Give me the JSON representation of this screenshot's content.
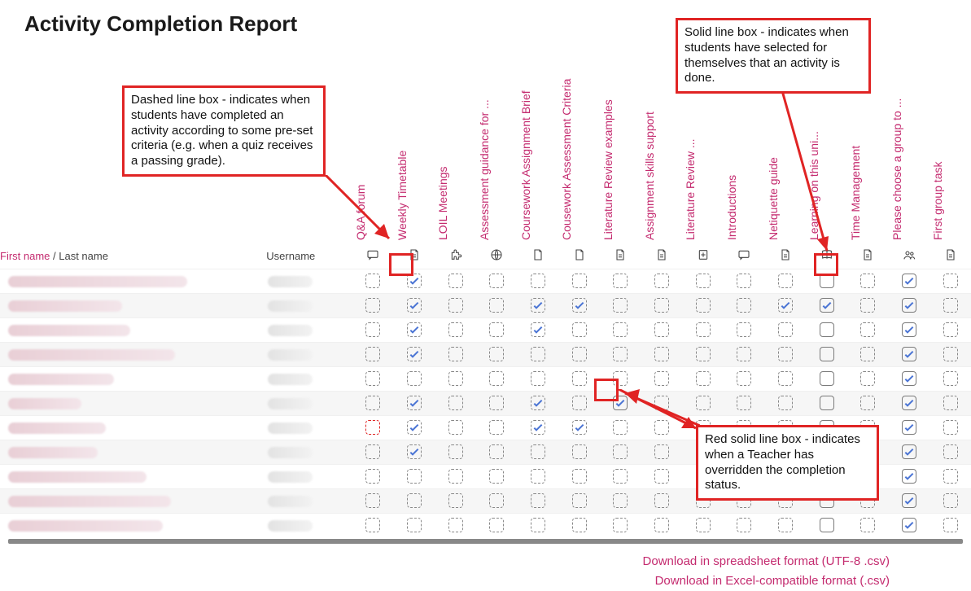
{
  "title": "Activity Completion Report",
  "header": {
    "first": "First name",
    "sep": " / ",
    "last": "Last name",
    "user": "Username"
  },
  "activities": [
    {
      "name": "Q&A forum",
      "icon": "forum"
    },
    {
      "name": "Weekly Timetable",
      "icon": "page"
    },
    {
      "name": "LOIL Meetings",
      "icon": "puzzle"
    },
    {
      "name": "Assessment guidance for ...",
      "icon": "globe"
    },
    {
      "name": "Coursework Assignment Brief",
      "icon": "file"
    },
    {
      "name": "Cousework Assessment Criteria",
      "icon": "file"
    },
    {
      "name": "Literature Review examples",
      "icon": "page"
    },
    {
      "name": "Assignment skills support",
      "icon": "page"
    },
    {
      "name": "Literature Review ...",
      "icon": "doc"
    },
    {
      "name": "Introductions",
      "icon": "forum"
    },
    {
      "name": "Netiquette guide",
      "icon": "page"
    },
    {
      "name": "Learning on this uni...",
      "icon": "book"
    },
    {
      "name": "Time Management",
      "icon": "page"
    },
    {
      "name": "Please choose a group to ...",
      "icon": "group"
    },
    {
      "name": "First group task",
      "icon": "page"
    }
  ],
  "icon_map": {
    "forum": "forum",
    "page": "page",
    "puzzle": "puzzle",
    "globe": "globe",
    "file": "file",
    "doc": "doc",
    "book": "book",
    "group": "group"
  },
  "students": [
    {
      "nw": 220,
      "cells": [
        "d",
        "dc",
        "d",
        "d",
        "d",
        "d",
        "d",
        "d",
        "d",
        "d",
        "d",
        "s",
        "d",
        "sc",
        "d"
      ]
    },
    {
      "nw": 140,
      "cells": [
        "d",
        "dc",
        "d",
        "d",
        "dc",
        "dc",
        "d",
        "d",
        "d",
        "d",
        "dc",
        "sc",
        "d",
        "sc",
        "d"
      ]
    },
    {
      "nw": 150,
      "cells": [
        "d",
        "dc",
        "d",
        "d",
        "dc",
        "d",
        "d",
        "d",
        "d",
        "d",
        "d",
        "s",
        "d",
        "sc",
        "d"
      ]
    },
    {
      "nw": 205,
      "cells": [
        "d",
        "dc",
        "d",
        "d",
        "d",
        "d",
        "d",
        "d",
        "d",
        "d",
        "d",
        "s",
        "d",
        "sc",
        "d"
      ]
    },
    {
      "nw": 130,
      "cells": [
        "d",
        "d",
        "d",
        "d",
        "d",
        "d",
        "d",
        "d",
        "d",
        "d",
        "d",
        "s",
        "d",
        "sc",
        "d"
      ]
    },
    {
      "nw": 90,
      "cells": [
        "d",
        "dc",
        "d",
        "d",
        "dc",
        "d",
        "sc",
        "d",
        "d",
        "d",
        "d",
        "s",
        "d",
        "sc",
        "d"
      ]
    },
    {
      "nw": 120,
      "cells": [
        "rd",
        "dc",
        "d",
        "d",
        "dc",
        "dc",
        "d",
        "d",
        "d",
        "d",
        "d",
        "s",
        "d",
        "sc",
        "d"
      ]
    },
    {
      "nw": 110,
      "cells": [
        "d",
        "dc",
        "d",
        "d",
        "d",
        "d",
        "d",
        "d",
        "d",
        "d",
        "d",
        "s",
        "d",
        "sc",
        "d"
      ]
    },
    {
      "nw": 170,
      "cells": [
        "d",
        "d",
        "d",
        "d",
        "d",
        "d",
        "d",
        "d",
        "d",
        "d",
        "d",
        "s",
        "d",
        "sc",
        "d"
      ]
    },
    {
      "nw": 200,
      "cells": [
        "d",
        "d",
        "d",
        "d",
        "d",
        "d",
        "d",
        "d",
        "d",
        "d",
        "d",
        "s",
        "d",
        "sc",
        "d"
      ]
    },
    {
      "nw": 190,
      "cells": [
        "d",
        "d",
        "d",
        "d",
        "d",
        "d",
        "d",
        "d",
        "d",
        "d",
        "d",
        "s",
        "d",
        "sc",
        "d"
      ]
    }
  ],
  "cell_legend": {
    "d": "dashed empty (auto-tracked, not complete)",
    "dc": "dashed checked (auto-tracked, completed)",
    "s": "solid empty (self-marked, not complete)",
    "sc": "solid checked (self-marked, completed)",
    "rd": "red dashed (teacher override)"
  },
  "downloads": {
    "utf8": "Download in spreadsheet format (UTF-8 .csv)",
    "excel": "Download in Excel-compatible format (.csv)"
  },
  "callouts": {
    "dashed": "Dashed line box - indicates when students have completed an activity according to some pre-set criteria (e.g. when a quiz receives a passing grade).",
    "solid": "Solid line box - indicates when students have selected for themselves that an activity is done.",
    "red": "Red solid line box - indicates when a Teacher has overridden the completion status."
  }
}
